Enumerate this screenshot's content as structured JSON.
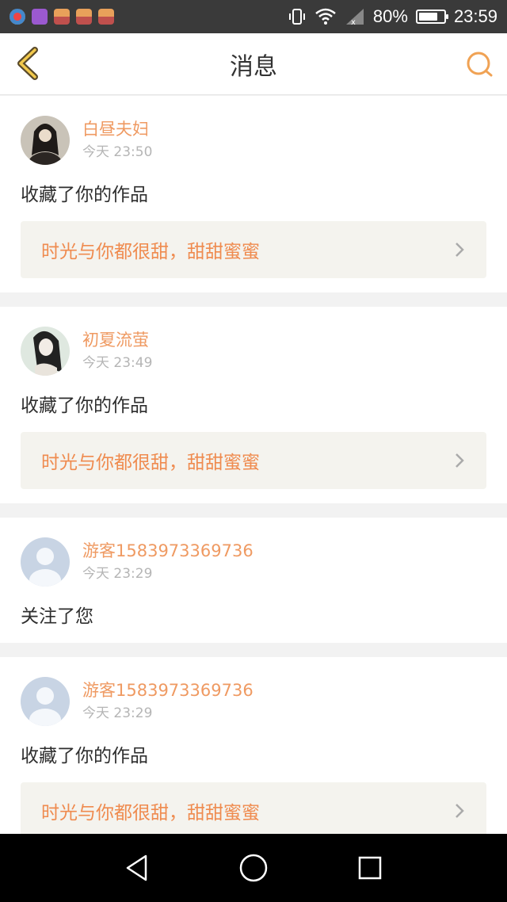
{
  "status": {
    "battery_pct_label": "80%",
    "battery_level": 0.8,
    "time": "23:59",
    "icons": [
      "app-icon-1",
      "gallery-icon",
      "game-icon",
      "game-icon",
      "game-icon",
      "vibrate-icon",
      "wifi-icon",
      "signal-icon",
      "battery-icon"
    ]
  },
  "header": {
    "title": "消息",
    "accent_color": "#f0a254"
  },
  "messages": [
    {
      "user": "白昼夫妇",
      "time": "今天 23:50",
      "action": "收藏了你的作品",
      "work": "时光与你都很甜，甜甜蜜蜜",
      "avatar": "photo"
    },
    {
      "user": "初夏流萤",
      "time": "今天 23:49",
      "action": "收藏了你的作品",
      "work": "时光与你都很甜，甜甜蜜蜜",
      "avatar": "photo"
    },
    {
      "user": "游客1583973369736",
      "time": "今天 23:29",
      "action": "关注了您",
      "avatar": "default"
    },
    {
      "user": "游客1583973369736",
      "time": "今天 23:29",
      "action": "收藏了你的作品",
      "work": "时光与你都很甜，甜甜蜜蜜",
      "avatar": "default"
    }
  ],
  "colors": {
    "username": "#ef9a62",
    "work_title": "#ef8b4f",
    "work_bg": "#f4f3ee"
  }
}
